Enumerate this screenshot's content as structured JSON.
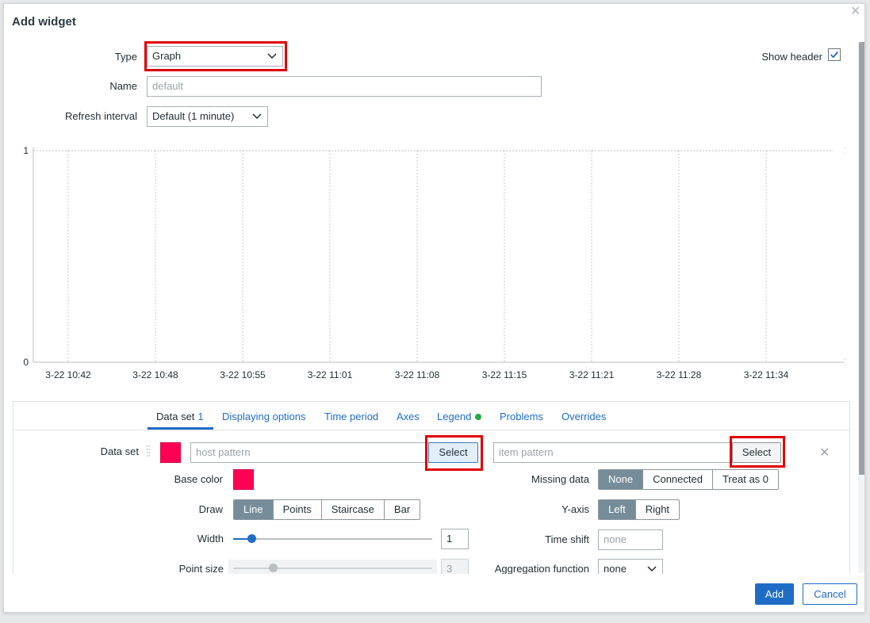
{
  "dialog": {
    "title": "Add widget",
    "close_glyph": "✕"
  },
  "form": {
    "type_label": "Type",
    "type_value": "Graph",
    "show_header_label": "Show header",
    "show_header_checked": true,
    "name_label": "Name",
    "name_placeholder": "default",
    "refresh_label": "Refresh interval",
    "refresh_value": "Default (1 minute)"
  },
  "chart_data": {
    "type": "line",
    "y_ticks": [
      "1",
      "0"
    ],
    "ylim": [
      0,
      1
    ],
    "x_ticks": [
      "3-22 10:42",
      "3-22 10:48",
      "3-22 10:55",
      "3-22 11:01",
      "3-22 11:08",
      "3-22 11:15",
      "3-22 11:21",
      "3-22 11:28",
      "3-22 11:34"
    ],
    "series": [],
    "grid": true
  },
  "tabs": [
    {
      "label": "Data set",
      "count": "1",
      "active": true
    },
    {
      "label": "Displaying options"
    },
    {
      "label": "Time period"
    },
    {
      "label": "Axes"
    },
    {
      "label": "Legend",
      "dot": true
    },
    {
      "label": "Problems"
    },
    {
      "label": "Overrides"
    }
  ],
  "dataset": {
    "label": "Data set",
    "color": "#ff0055",
    "host_placeholder": "host pattern",
    "item_placeholder": "item pattern",
    "select_label": "Select",
    "remove_glyph": "✕",
    "base_color_label": "Base color",
    "draw_label": "Draw",
    "draw_options": [
      "Line",
      "Points",
      "Staircase",
      "Bar"
    ],
    "draw_selected": "Line",
    "width_label": "Width",
    "width_value": "1",
    "width_fraction": 0.09,
    "point_size_label": "Point size",
    "point_size_value": "3",
    "point_size_fraction": 0.2,
    "missing_label": "Missing data",
    "missing_options": [
      "None",
      "Connected",
      "Treat as 0"
    ],
    "missing_selected": "None",
    "yaxis_label": "Y-axis",
    "yaxis_options": [
      "Left",
      "Right"
    ],
    "yaxis_selected": "Left",
    "timeshift_label": "Time shift",
    "timeshift_placeholder": "none",
    "aggregation_label": "Aggregation function",
    "aggregation_value": "none"
  },
  "footer": {
    "add_label": "Add",
    "cancel_label": "Cancel"
  },
  "colors": {
    "accent": "#1f6cc7",
    "highlight_box": "#e00000",
    "dataset_color": "#ff0055",
    "segment_selected": "#768d99"
  }
}
